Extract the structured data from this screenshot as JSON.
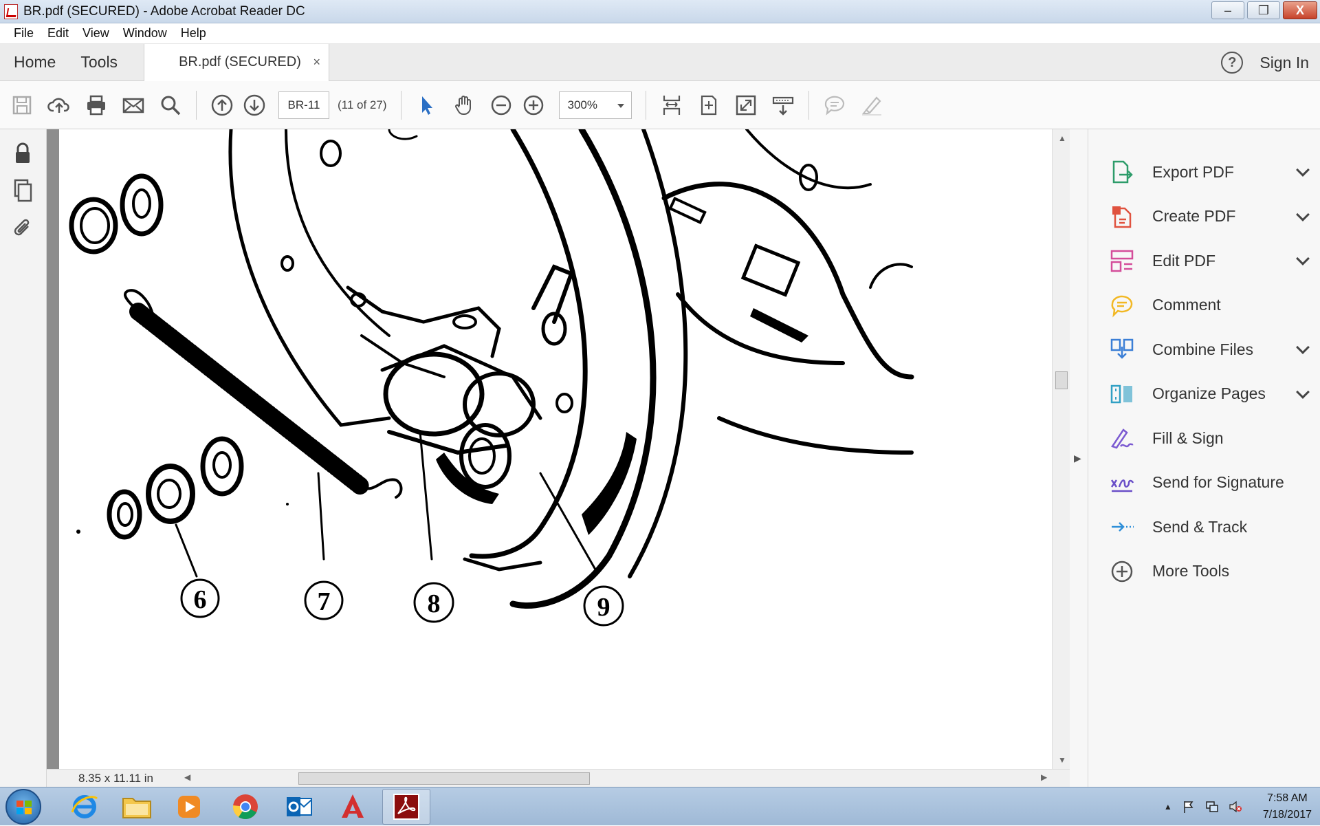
{
  "window": {
    "title": "BR.pdf (SECURED) - Adobe Acrobat Reader DC",
    "controls": {
      "minimize": "–",
      "restore": "❐",
      "close": "X"
    }
  },
  "menu": [
    "File",
    "Edit",
    "View",
    "Window",
    "Help"
  ],
  "tabs": {
    "home": "Home",
    "tools": "Tools",
    "document": "BR.pdf (SECURED)",
    "close": "×",
    "help": "?",
    "sign_in": "Sign In"
  },
  "toolbar": {
    "page_label": "BR-11",
    "page_count": "(11 of 27)",
    "zoom": "300%"
  },
  "document": {
    "page_size": "8.35 x 11.11 in",
    "callouts": [
      "6",
      "7",
      "8",
      "9"
    ]
  },
  "tools_pane": [
    {
      "label": "Export PDF",
      "icon": "export-pdf-icon",
      "expandable": true,
      "color": "#2d9c6a"
    },
    {
      "label": "Create PDF",
      "icon": "create-pdf-icon",
      "expandable": true,
      "color": "#e0523f"
    },
    {
      "label": "Edit PDF",
      "icon": "edit-pdf-icon",
      "expandable": true,
      "color": "#d44d9a"
    },
    {
      "label": "Comment",
      "icon": "comment-icon",
      "expandable": false,
      "color": "#f2b824"
    },
    {
      "label": "Combine Files",
      "icon": "combine-files-icon",
      "expandable": true,
      "color": "#3b7fd6"
    },
    {
      "label": "Organize Pages",
      "icon": "organize-pages-icon",
      "expandable": true,
      "color": "#31a0c4"
    },
    {
      "label": "Fill & Sign",
      "icon": "fill-sign-icon",
      "expandable": false,
      "color": "#7b5ad1"
    },
    {
      "label": "Send for Signature",
      "icon": "send-signature-icon",
      "expandable": false,
      "color": "#6a4fc8"
    },
    {
      "label": "Send & Track",
      "icon": "send-track-icon",
      "expandable": false,
      "color": "#2f8fd8"
    },
    {
      "label": "More Tools",
      "icon": "more-tools-icon",
      "expandable": false,
      "color": "#555555"
    }
  ],
  "taskbar": {
    "apps": [
      "internet-explorer-icon",
      "file-explorer-icon",
      "media-player-icon",
      "chrome-icon",
      "outlook-icon",
      "autocad-icon",
      "acrobat-icon"
    ],
    "time": "7:58 AM",
    "date": "7/18/2017"
  }
}
